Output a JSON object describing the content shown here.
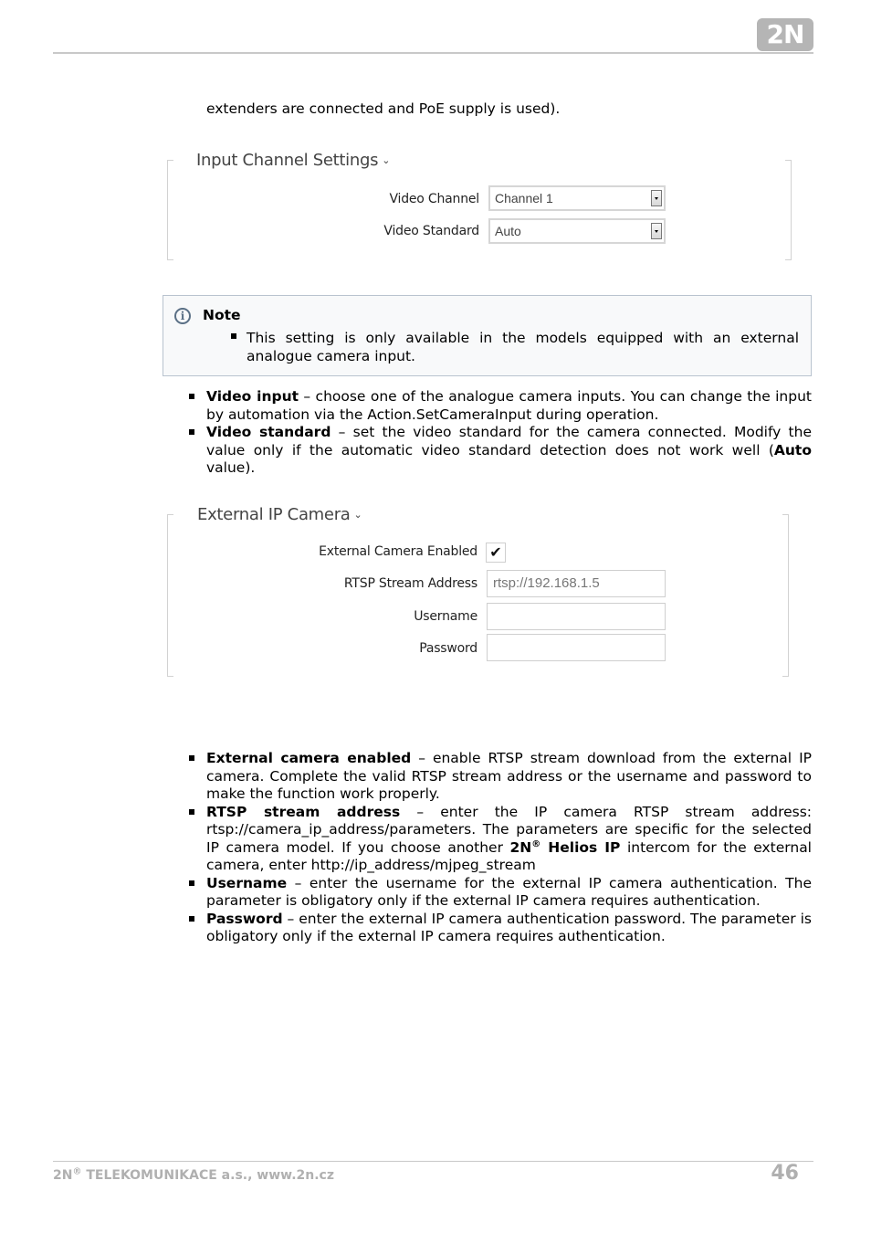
{
  "header": {
    "logo_text": "2N"
  },
  "intro_text": "extenders are connected and PoE supply is used).",
  "input_channel_panel": {
    "title": "Input Channel Settings",
    "fields": [
      {
        "label": "Video Channel",
        "value": "Channel 1"
      },
      {
        "label": "Video Standard",
        "value": "Auto"
      }
    ]
  },
  "note": {
    "title": "Note",
    "items": [
      "This setting is only available in the models equipped with an external analogue camera input."
    ]
  },
  "bullets_1": [
    {
      "term": "Video input",
      "text": " – choose one of the analogue camera inputs. You can change the input by automation via the Action.SetCameraInput during operation."
    },
    {
      "term": "Video standard",
      "text": " – set the video standard for the camera connected. Modify the value only if the automatic video standard detection does not work well (",
      "term2": "Auto",
      "text2": " value)."
    }
  ],
  "external_ip_panel": {
    "title": "External IP Camera",
    "enabled_label": "External Camera Enabled",
    "enabled_checked": true,
    "check_glyph": "✔",
    "rtsp_label": "RTSP Stream Address",
    "rtsp_value": "rtsp://192.168.1.5",
    "username_label": "Username",
    "username_value": "",
    "password_label": "Password",
    "password_value": ""
  },
  "bullets_2": [
    {
      "term": "External camera enabled",
      "text": " – enable RTSP stream download from the external IP camera. Complete the valid RTSP stream address or the username and password to make the function work properly."
    },
    {
      "term": "RTSP stream address",
      "text": " – enter the IP camera RTSP stream address: rtsp://camera_ip_address/parameters. The parameters are specific for the selected IP camera model. If you choose another ",
      "term2": "2N",
      "sup": "®",
      "term3": " Helios IP",
      "text2": " intercom for the external camera, enter http://ip_address/mjpeg_stream"
    },
    {
      "term": "Username",
      "text": " – enter the username for the external IP camera authentication. The parameter is obligatory only if the external IP camera requires authentication."
    },
    {
      "term": "Password",
      "text": " – enter the external IP camera authentication password. The parameter is obligatory only if the external IP camera requires authentication."
    }
  ],
  "footer": {
    "company_prefix": "2N",
    "registered": "®",
    "company_rest": " TELEKOMUNIKACE a.s., www.2n.cz",
    "page_number": "46"
  }
}
